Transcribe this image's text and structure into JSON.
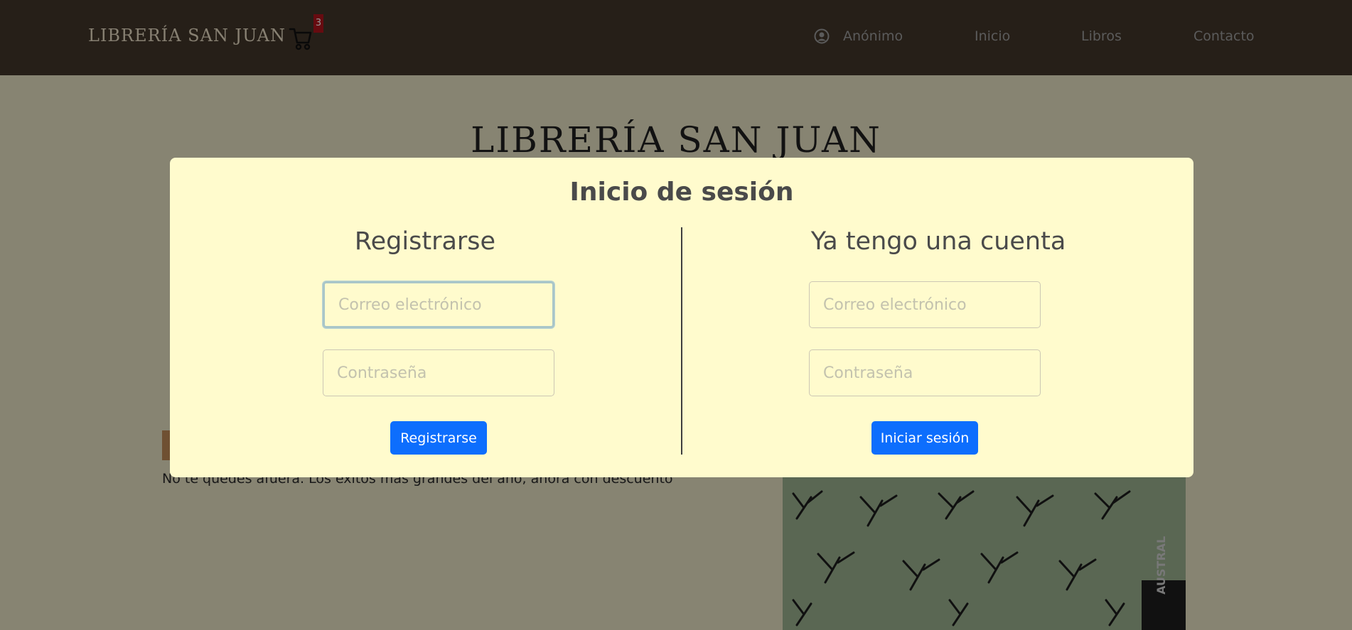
{
  "navbar": {
    "brand": "LIBRERÍA SAN JUAN",
    "cart_count": "3",
    "user_label": "Anónimo",
    "links": [
      "Inicio",
      "Libros",
      "Contacto"
    ]
  },
  "page": {
    "hero_title": "LIBRERÍA SAN JUAN",
    "promo_text": "No te quedes afuera. Los éxitos más grandes del año, ahora con descuento",
    "book_spine": "AUSTRAL"
  },
  "modal": {
    "title": "Inicio de sesión",
    "register": {
      "heading": "Registrarse",
      "email_placeholder": "Correo electrónico",
      "password_placeholder": "Contraseña",
      "button": "Registrarse"
    },
    "login": {
      "heading": "Ya tengo una cuenta",
      "email_placeholder": "Correo electrónico",
      "password_placeholder": "Contraseña",
      "button": "Iniciar sesión"
    }
  },
  "colors": {
    "navbar_bg": "#43362a",
    "modal_bg": "#fffbcd",
    "primary_button": "#0d6efd",
    "badge": "#b0131c"
  },
  "icons": {
    "cart": "shopping-cart-icon",
    "user": "user-circle-icon"
  }
}
